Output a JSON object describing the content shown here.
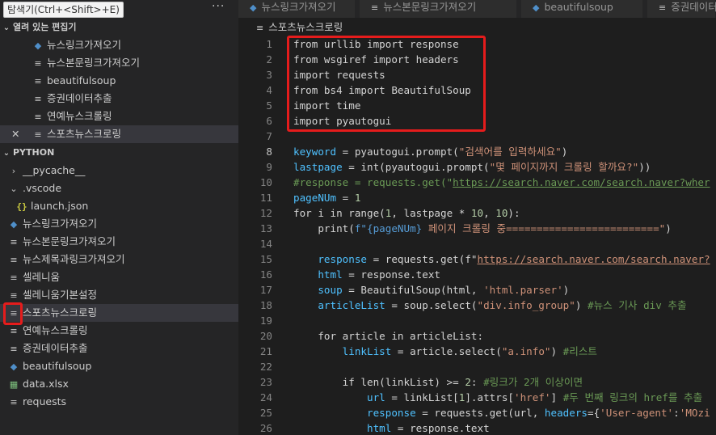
{
  "explorer": {
    "title": "탐색기(Ctrl+<Shift>+E)",
    "more": "···",
    "open_editors_label": "열려 있는 편집기",
    "open_editors": [
      {
        "label": "뉴스링크가져오기",
        "icon": "python-icon"
      },
      {
        "label": "뉴스본문링크가져오기",
        "icon": "file-icon"
      },
      {
        "label": "beautifulsoup",
        "icon": "file-icon"
      },
      {
        "label": "증권데이터추출",
        "icon": "file-icon"
      },
      {
        "label": "연예뉴스크롤링",
        "icon": "file-icon"
      },
      {
        "label": "스포츠뉴스크로링",
        "icon": "file-icon",
        "close": "✕"
      }
    ],
    "project_label": "PYTHON",
    "tree": [
      {
        "label": "__pycache__",
        "icon": "chevron-right-icon"
      },
      {
        "label": ".vscode",
        "icon": "chevron-down-icon"
      },
      {
        "label": "launch.json",
        "icon": "json-icon",
        "glyph": "{}"
      },
      {
        "label": "뉴스링크가져오기",
        "icon": "python-icon"
      },
      {
        "label": "뉴스본문링크가져오기",
        "icon": "file-icon"
      },
      {
        "label": "뉴스제목과링크가져오기",
        "icon": "file-icon"
      },
      {
        "label": "셀레니움",
        "icon": "file-icon"
      },
      {
        "label": "셀레니움기본설정",
        "icon": "file-icon"
      },
      {
        "label": "스포츠뉴스크로링",
        "icon": "file-icon"
      },
      {
        "label": "연예뉴스크롤링",
        "icon": "file-icon"
      },
      {
        "label": "증권데이터추출",
        "icon": "file-icon"
      },
      {
        "label": "beautifulsoup",
        "icon": "python-icon"
      },
      {
        "label": "data.xlsx",
        "icon": "excel-icon"
      },
      {
        "label": "requests",
        "icon": "file-icon"
      }
    ]
  },
  "tabs": [
    {
      "label": "뉴스링크가져오기",
      "icon": "python-icon"
    },
    {
      "label": "뉴스본문링크가져오기",
      "icon": "file-icon"
    },
    {
      "label": "beautifulsoup",
      "icon": "python-icon"
    },
    {
      "label": "증권데이터",
      "icon": "file-icon"
    }
  ],
  "breadcrumb": "스포츠뉴스크로링",
  "colors": {
    "annotation": "#e51c1c",
    "selection": "#37373d",
    "keyword_var": "#4fc1ff",
    "string": "#ce9178",
    "comment": "#6a9955"
  },
  "code_lines": [
    {
      "n": "1",
      "tokens": [
        [
          "from urllib import response",
          "kw"
        ]
      ]
    },
    {
      "n": "2",
      "tokens": [
        [
          "from wsgiref import headers",
          "kw"
        ]
      ]
    },
    {
      "n": "3",
      "tokens": [
        [
          "import requests",
          "kw"
        ]
      ]
    },
    {
      "n": "4",
      "tokens": [
        [
          "from bs4 import BeautifulSoup",
          "kw"
        ]
      ]
    },
    {
      "n": "5",
      "tokens": [
        [
          "import time",
          "kw"
        ]
      ]
    },
    {
      "n": "6",
      "tokens": [
        [
          "import pyautogui",
          "kw"
        ]
      ]
    },
    {
      "n": "7",
      "tokens": []
    },
    {
      "n": "8",
      "tokens": [
        [
          "keyword",
          "var"
        ],
        [
          " = pyautogui.prompt(",
          "kw"
        ],
        [
          "\"검색어를 입력하세요\"",
          "str"
        ],
        [
          ")",
          "kw"
        ]
      ]
    },
    {
      "n": "9",
      "tokens": [
        [
          "lastpage",
          "var"
        ],
        [
          " = int(pyautogui.prompt(",
          "kw"
        ],
        [
          "\"몇 페이지까지 크롤링 할까요?\"",
          "str"
        ],
        [
          "))",
          "kw"
        ]
      ]
    },
    {
      "n": "10",
      "tokens": [
        [
          "#response = requests.get(\"",
          "com"
        ],
        [
          "https://search.naver.com/search.naver?wher",
          "comurl"
        ]
      ]
    },
    {
      "n": "11",
      "tokens": [
        [
          "pageNUm",
          "var"
        ],
        [
          " = ",
          "kw"
        ],
        [
          "1",
          "num"
        ]
      ]
    },
    {
      "n": "12",
      "tokens": [
        [
          "for i in range(",
          "kw"
        ],
        [
          "1",
          "num"
        ],
        [
          ", lastpage * ",
          "kw"
        ],
        [
          "10",
          "num"
        ],
        [
          ", ",
          "kw"
        ],
        [
          "10",
          "num"
        ],
        [
          "):",
          "kw"
        ]
      ]
    },
    {
      "n": "13",
      "tokens": [
        [
          "    print(",
          "kw"
        ],
        [
          "f\"",
          "fmt"
        ],
        [
          "{pageNUm}",
          "fmt"
        ],
        [
          " 페이지 크롤링 중=========================\"",
          "str"
        ],
        [
          ")",
          "kw"
        ]
      ]
    },
    {
      "n": "14",
      "tokens": []
    },
    {
      "n": "15",
      "tokens": [
        [
          "    ",
          "kw"
        ],
        [
          "response",
          "var"
        ],
        [
          " = requests.get(f\"",
          "kw"
        ],
        [
          "https://search.naver.com/search.naver?",
          "url"
        ]
      ]
    },
    {
      "n": "16",
      "tokens": [
        [
          "    ",
          "kw"
        ],
        [
          "html",
          "var"
        ],
        [
          " = response.text",
          "kw"
        ]
      ]
    },
    {
      "n": "17",
      "tokens": [
        [
          "    ",
          "kw"
        ],
        [
          "soup",
          "var"
        ],
        [
          " = BeautifulSoup(html, ",
          "kw"
        ],
        [
          "'html.parser'",
          "str"
        ],
        [
          ")",
          "kw"
        ]
      ]
    },
    {
      "n": "18",
      "tokens": [
        [
          "    ",
          "kw"
        ],
        [
          "articleList",
          "var"
        ],
        [
          " = soup.select(",
          "kw"
        ],
        [
          "\"div.info_group\"",
          "str"
        ],
        [
          ") ",
          "kw"
        ],
        [
          "#뉴스 기사 div 추출",
          "com"
        ]
      ]
    },
    {
      "n": "19",
      "tokens": []
    },
    {
      "n": "20",
      "tokens": [
        [
          "    for article in articleList:",
          "kw"
        ]
      ]
    },
    {
      "n": "21",
      "tokens": [
        [
          "        ",
          "kw"
        ],
        [
          "linkList",
          "var"
        ],
        [
          " = article.select(",
          "kw"
        ],
        [
          "\"a.info\"",
          "str"
        ],
        [
          ") ",
          "kw"
        ],
        [
          "#리스트",
          "com"
        ]
      ]
    },
    {
      "n": "22",
      "tokens": []
    },
    {
      "n": "23",
      "tokens": [
        [
          "        if len(linkList) >= ",
          "kw"
        ],
        [
          "2",
          "num"
        ],
        [
          ": ",
          "kw"
        ],
        [
          "#링크가 2개 이상이면",
          "com"
        ]
      ]
    },
    {
      "n": "24",
      "tokens": [
        [
          "            ",
          "kw"
        ],
        [
          "url",
          "var"
        ],
        [
          " = linkList[",
          "kw"
        ],
        [
          "1",
          "num"
        ],
        [
          "].attrs[",
          "kw"
        ],
        [
          "'href'",
          "str"
        ],
        [
          "] ",
          "kw"
        ],
        [
          "#두 번째 링크의 href를 추출",
          "com"
        ]
      ]
    },
    {
      "n": "25",
      "tokens": [
        [
          "            ",
          "kw"
        ],
        [
          "response",
          "var"
        ],
        [
          " = requests.get(url, ",
          "kw"
        ],
        [
          "headers",
          "var"
        ],
        [
          "={",
          "kw"
        ],
        [
          "'User-agent'",
          "str"
        ],
        [
          ":",
          "kw"
        ],
        [
          "'MOzi",
          "str"
        ]
      ]
    },
    {
      "n": "26",
      "tokens": [
        [
          "            ",
          "kw"
        ],
        [
          "html",
          "var"
        ],
        [
          " = response.text",
          "kw"
        ]
      ]
    }
  ]
}
